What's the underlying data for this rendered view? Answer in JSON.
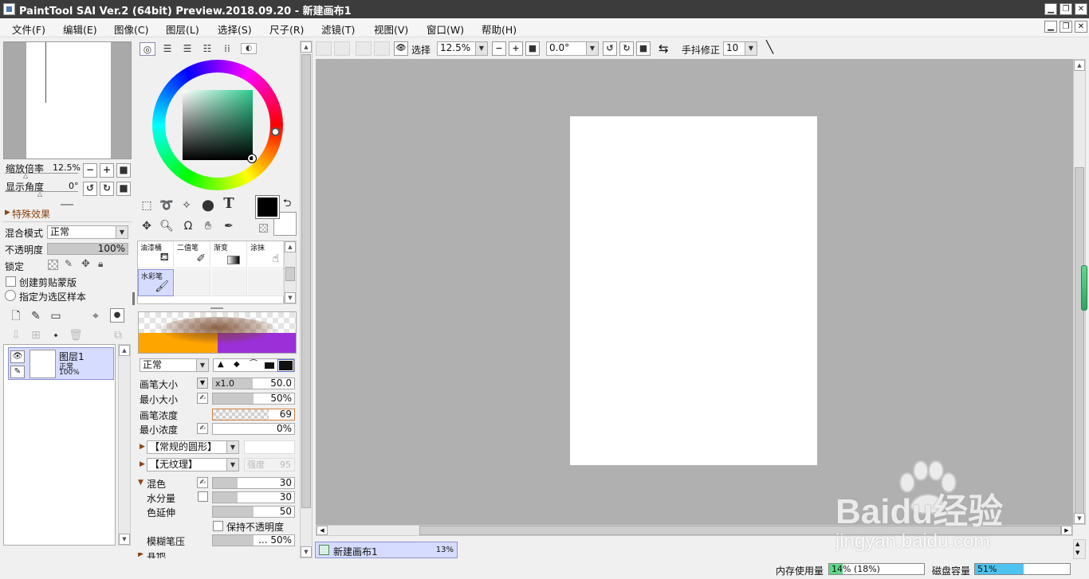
{
  "window": {
    "title": "PaintTool SAI Ver.2 (64bit) Preview.2018.09.20 - 新建画布1",
    "minimize": "▁",
    "restore": "❐",
    "close": "✕"
  },
  "menu": [
    {
      "label": "文件(F)"
    },
    {
      "label": "编辑(E)"
    },
    {
      "label": "图像(C)"
    },
    {
      "label": "图层(L)"
    },
    {
      "label": "选择(S)"
    },
    {
      "label": "尺子(R)"
    },
    {
      "label": "滤镜(T)"
    },
    {
      "label": "视图(V)"
    },
    {
      "label": "窗口(W)"
    },
    {
      "label": "帮助(H)"
    }
  ],
  "navigator": {
    "zoom_label": "缩放倍率",
    "zoom_value": "12.5%",
    "angle_label": "显示角度",
    "angle_value": "0°"
  },
  "layer_props": {
    "effects_label": "特殊效果",
    "blend_label": "混合模式",
    "blend_value": "正常",
    "opacity_label": "不透明度",
    "opacity_value": "100%",
    "opacity_fraction": 1.0,
    "lock_label": "锁定",
    "clip_label": "创建剪贴蒙版",
    "select_source_label": "指定为选区样本"
  },
  "layers": [
    {
      "name": "图层1",
      "mode": "正常",
      "opacity": "100%"
    }
  ],
  "brushes": [
    {
      "name": "油漆桶",
      "icon": "bucket-icon"
    },
    {
      "name": "二值笔",
      "icon": "pen-icon"
    },
    {
      "name": "渐变",
      "icon": "gradient-icon"
    },
    {
      "name": "涂抹",
      "icon": "smudge-icon"
    },
    {
      "name": "水彩笔",
      "icon": "watercolor-icon"
    }
  ],
  "brush_settings": {
    "mode_value": "正常",
    "size_label": "画笔大小",
    "size_mult": "x1.0",
    "size_value": "50.0",
    "min_size_label": "最小大小",
    "min_size_value": "50%",
    "min_size_fraction": 0.5,
    "density_label": "画笔浓度",
    "density_value": "69",
    "density_fraction": 0.69,
    "min_density_label": "最小浓度",
    "min_density_value": "0%",
    "min_density_fraction": 0.0,
    "shape_value": "【常规的圆形】",
    "texture_value": "【无纹理】",
    "strength_label": "强度",
    "strength_value": "95",
    "blend_label": "混色",
    "blend_value": "30",
    "blend_fraction": 0.3,
    "water_label": "水分量",
    "water_value": "30",
    "water_fraction": 0.3,
    "stretch_label": "色延伸",
    "stretch_value": "50",
    "stretch_fraction": 0.5,
    "keep_opacity_label": "保持不透明度",
    "blur_label": "模糊笔压",
    "blur_value": "... 50%",
    "blur_fraction": 0.5,
    "other_label": "其他"
  },
  "toolbar": {
    "select_label": "选择",
    "zoom_value": "12.5%",
    "angle_value": "0.0°",
    "stabilizer_label": "手抖修正",
    "stabilizer_value": "10"
  },
  "document_tab": {
    "name": "新建画布1",
    "zoom": "13%"
  },
  "status": {
    "memory_label": "内存使用量",
    "memory_value": "14% (18%)",
    "memory_fraction": 0.14,
    "disk_label": "磁盘容量",
    "disk_value": "51%",
    "disk_fraction": 0.51
  },
  "colors": {
    "foreground": "#000000",
    "background": "#ffffff",
    "selected_hue": "#2ecc8f",
    "memory_bar": "#5fd88a",
    "disk_bar": "#4ec3f0"
  },
  "watermark": {
    "brand": "Baidu经验",
    "url": "jingyan.baidu.com"
  }
}
